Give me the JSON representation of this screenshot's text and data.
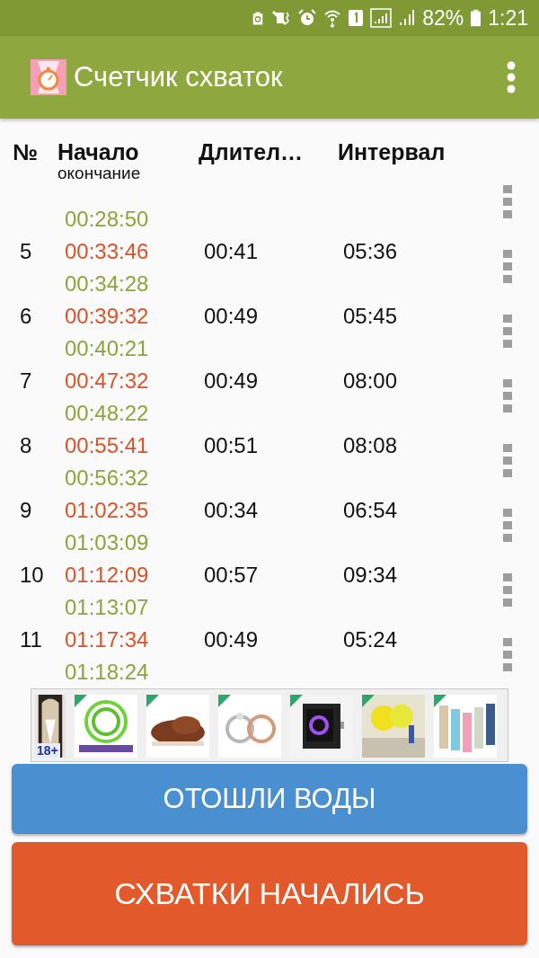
{
  "status_bar": {
    "battery": "82%",
    "time": "1:21"
  },
  "app_bar": {
    "title": "Счетчик схваток"
  },
  "table": {
    "columns": [
      "№",
      "Начало",
      "Длител…",
      "Интервал"
    ],
    "subheading": "окончание",
    "rows": [
      {
        "end": "00:28:50"
      },
      {
        "number": "5",
        "start": "00:33:46",
        "end": "00:34:28",
        "duration": "00:41",
        "interval": "05:36"
      },
      {
        "number": "6",
        "start": "00:39:32",
        "end": "00:40:21",
        "duration": "00:49",
        "interval": "05:45"
      },
      {
        "number": "7",
        "start": "00:47:32",
        "end": "00:48:22",
        "duration": "00:49",
        "interval": "08:00"
      },
      {
        "number": "8",
        "start": "00:55:41",
        "end": "00:56:32",
        "duration": "00:51",
        "interval": "08:08"
      },
      {
        "number": "9",
        "start": "01:02:35",
        "end": "01:03:09",
        "duration": "00:34",
        "interval": "06:54"
      },
      {
        "number": "10",
        "start": "01:12:09",
        "end": "01:13:07",
        "duration": "00:57",
        "interval": "09:34"
      },
      {
        "number": "11",
        "start": "01:17:34",
        "end": "01:18:24",
        "duration": "00:49",
        "interval": "05:24"
      }
    ]
  },
  "ad": {
    "badge": "18+"
  },
  "buttons": [
    {
      "label": "ОТОШЛИ ВОДЫ",
      "kind": "secondary"
    },
    {
      "label": "СХВАТКИ НАЧАЛИСЬ",
      "kind": "primary"
    }
  ]
}
